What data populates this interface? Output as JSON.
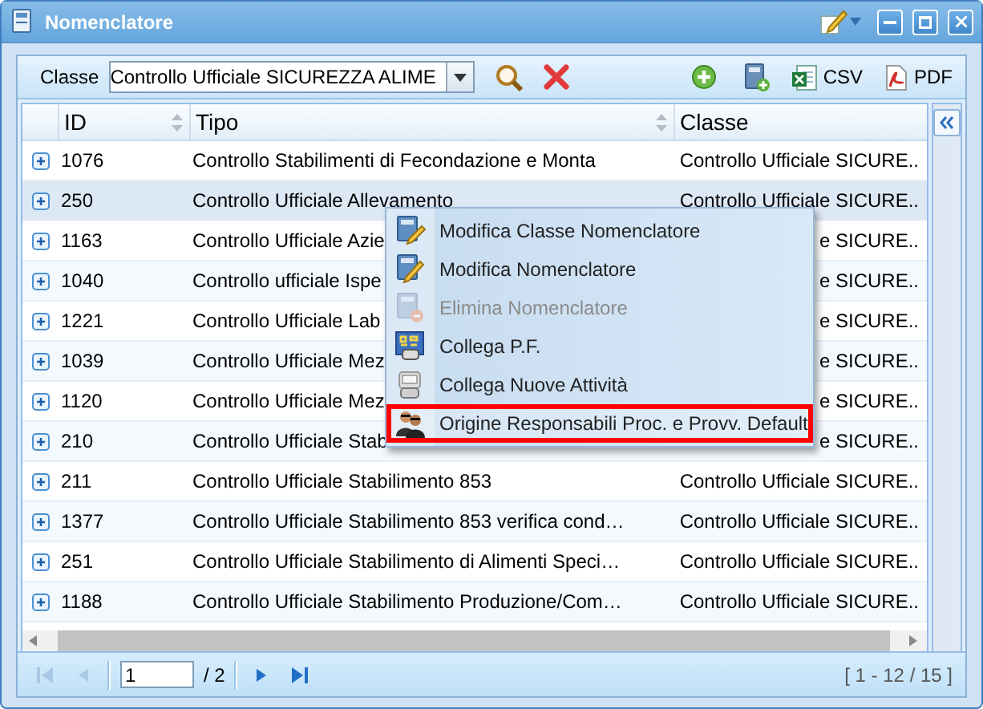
{
  "window": {
    "title": "Nomenclatore"
  },
  "toolbar": {
    "filter_label": "Classe",
    "filter_value": "Controllo Ufficiale SICUREZZA ALIME",
    "export_buttons": [
      "CSV",
      "PDF"
    ]
  },
  "grid": {
    "columns": [
      "ID",
      "Tipo",
      "Classe"
    ],
    "rows": [
      {
        "id": "1076",
        "tipo": "Controllo Stabilimenti di Fecondazione e Monta",
        "classe": "Controllo Ufficiale SICURE..",
        "selected": false
      },
      {
        "id": "250",
        "tipo": "Controllo Ufficiale Allevamento",
        "classe": "Controllo Ufficiale SICURE..",
        "selected": true
      },
      {
        "id": "1163",
        "tipo": "Controllo Ufficiale Azie",
        "classe": "e SICURE..",
        "selected": false
      },
      {
        "id": "1040",
        "tipo": "Controllo ufficiale Ispe",
        "classe": "e SICURE..",
        "selected": false
      },
      {
        "id": "1221",
        "tipo": "Controllo Ufficiale Lab",
        "classe": "e SICURE..",
        "selected": false
      },
      {
        "id": "1039",
        "tipo": "Controllo Ufficiale Mez",
        "classe": "e SICURE..",
        "selected": false
      },
      {
        "id": "1120",
        "tipo": "Controllo Ufficiale Mez",
        "classe": "e SICURE..",
        "selected": false
      },
      {
        "id": "210",
        "tipo": "Controllo Ufficiale Stab",
        "classe": "e SICURE..",
        "selected": false
      },
      {
        "id": "211",
        "tipo": "Controllo Ufficiale Stabilimento 853",
        "classe": "Controllo Ufficiale SICURE..",
        "selected": false
      },
      {
        "id": "1377",
        "tipo": "Controllo Ufficiale Stabilimento 853 verifica cond…",
        "classe": "Controllo Ufficiale SICURE..",
        "selected": false
      },
      {
        "id": "251",
        "tipo": "Controllo Ufficiale Stabilimento di Alimenti Speci…",
        "classe": "Controllo Ufficiale SICURE..",
        "selected": false
      },
      {
        "id": "1188",
        "tipo": "Controllo Ufficiale Stabilimento Produzione/Com…",
        "classe": "Controllo Ufficiale SICURE..",
        "selected": false
      }
    ]
  },
  "context_menu": {
    "items": [
      {
        "label": "Modifica Classe Nomenclatore",
        "disabled": false,
        "selected": false
      },
      {
        "label": "Modifica Nomenclatore",
        "disabled": false,
        "selected": false
      },
      {
        "label": "Elimina Nomenclatore",
        "disabled": true,
        "selected": false
      },
      {
        "label": "Collega P.F.",
        "disabled": false,
        "selected": false
      },
      {
        "label": "Collega Nuove Attività",
        "disabled": false,
        "selected": false
      },
      {
        "label": "Origine Responsabili Proc. e Provv. Default",
        "disabled": false,
        "selected": true
      }
    ]
  },
  "paging": {
    "page": "1",
    "total": "/ 2",
    "summary": "[ 1 - 12 / 15 ]"
  }
}
